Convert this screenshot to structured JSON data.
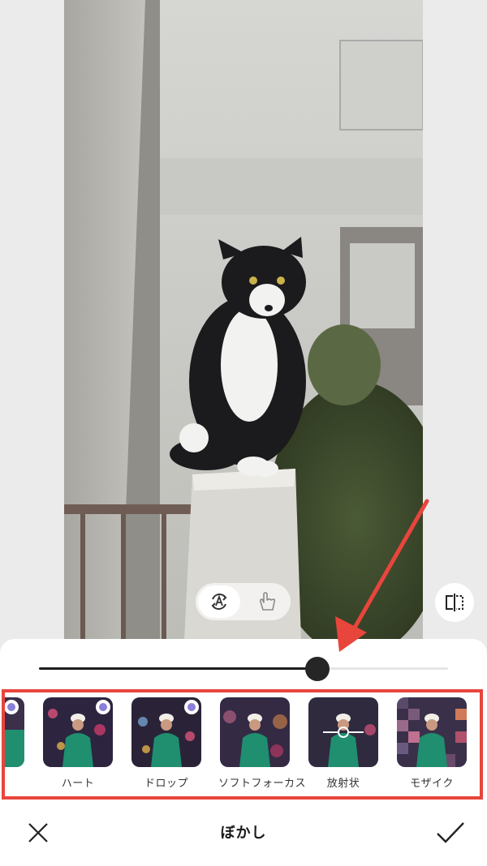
{
  "editor": {
    "title": "ぼかし",
    "slider": {
      "value": 0.68
    },
    "filters": [
      {
        "id": "partial",
        "label": ""
      },
      {
        "id": "heart",
        "label": "ハート"
      },
      {
        "id": "drop",
        "label": "ドロップ"
      },
      {
        "id": "soft-focus",
        "label": "ソフトフォーカス"
      },
      {
        "id": "radial",
        "label": "放射状"
      },
      {
        "id": "mosaic",
        "label": "モザイク"
      }
    ]
  },
  "icons": {
    "auto_mode": "auto-rotate-A-icon",
    "manual_mode": "hand-brush-icon",
    "compare": "compare-split-icon",
    "close": "close-x-icon",
    "confirm": "checkmark-icon"
  },
  "colors": {
    "highlight": "#e8453c",
    "annotation_arrow": "#e8453c",
    "slider_fill": "#1e1e1e",
    "panel_bg": "#ffffff"
  }
}
